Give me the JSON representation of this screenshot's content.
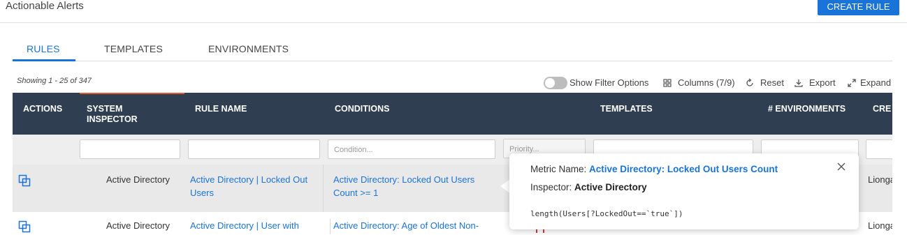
{
  "header": {
    "title": "Actionable Alerts",
    "create_button": "CREATE RULE"
  },
  "tabs": [
    {
      "label": "RULES",
      "active": true
    },
    {
      "label": "TEMPLATES",
      "active": false
    },
    {
      "label": "ENVIRONMENTS",
      "active": false
    }
  ],
  "toolbar": {
    "showing": "Showing 1 - 25 of 347",
    "filter_toggle_label": "Show Filter Options",
    "filter_toggle_on": false,
    "columns_label": "Columns (7/9)",
    "reset_label": "Reset",
    "export_label": "Export",
    "expand_label": "Expand"
  },
  "table": {
    "headers": {
      "actions": "ACTIONS",
      "system_inspector_1": "SYSTEM",
      "system_inspector_2": "INSPECTOR",
      "rule_name": "RULE NAME",
      "conditions": "CONDITIONS",
      "templates": "TEMPLATES",
      "environments": "# ENVIRONMENTS",
      "created": "CRE"
    },
    "filters": {
      "condition_placeholder": "Condition...",
      "priority_placeholder": "Priority..."
    },
    "rows": [
      {
        "inspector": "Active Directory",
        "rule_name_1": "Active Directory | Locked Out",
        "rule_name_2": "Users",
        "condition_1": "Active Directory: Locked Out Users",
        "condition_2": "Count >= 1",
        "created": "Lionga"
      },
      {
        "inspector": "Active Directory",
        "rule_name_1": "Active Directory | User with",
        "condition_1": "Active Directory: Age of Oldest Non-",
        "created": "Lionga"
      }
    ]
  },
  "popover": {
    "metric_label": "Metric Name:",
    "metric_value": "Active Directory: Locked Out Users Count",
    "inspector_label": "Inspector:",
    "inspector_value": "Active Directory",
    "expression": "length(Users[?LockedOut==`true`])"
  },
  "colors": {
    "accent": "#1a73d8",
    "header_bg": "#2f3e51",
    "highlight": "#e4572e"
  }
}
